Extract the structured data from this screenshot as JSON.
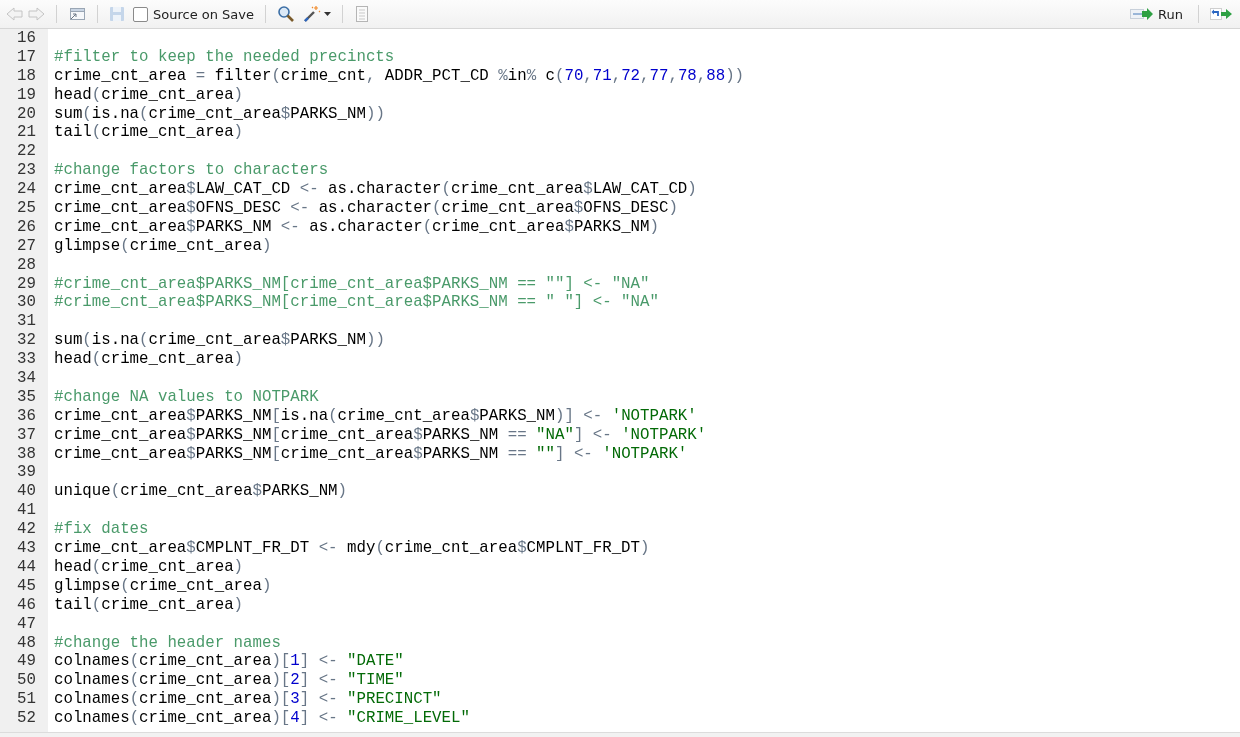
{
  "toolbar": {
    "source_on_save": {
      "label": "Source on Save",
      "checked": false
    },
    "run_button": {
      "label": "Run"
    }
  },
  "editor": {
    "lines": [
      {
        "number": "16"
      },
      {
        "number": "17",
        "text": "#filter to keep the needed precincts"
      },
      {
        "number": "18",
        "text": "crime_cnt_area = filter(crime_cnt, ADDR_PCT_CD %in% c(70,71,72,77,78,88))"
      },
      {
        "number": "19",
        "text": "head(crime_cnt_area)"
      },
      {
        "number": "20",
        "text": "sum(is.na(crime_cnt_area$PARKS_NM))"
      },
      {
        "number": "21",
        "text": "tail(crime_cnt_area)"
      },
      {
        "number": "22"
      },
      {
        "number": "23",
        "text": "#change factors to characters"
      },
      {
        "number": "24",
        "text": "crime_cnt_area$LAW_CAT_CD <- as.character(crime_cnt_area$LAW_CAT_CD)"
      },
      {
        "number": "25",
        "text": "crime_cnt_area$OFNS_DESC <- as.character(crime_cnt_area$OFNS_DESC)"
      },
      {
        "number": "26",
        "text": "crime_cnt_area$PARKS_NM <- as.character(crime_cnt_area$PARKS_NM)"
      },
      {
        "number": "27",
        "text": "glimpse(crime_cnt_area)"
      },
      {
        "number": "28"
      },
      {
        "number": "29",
        "text": "#crime_cnt_area$PARKS_NM[crime_cnt_area$PARKS_NM == \"\"] <- \"NA\""
      },
      {
        "number": "30",
        "text": "#crime_cnt_area$PARKS_NM[crime_cnt_area$PARKS_NM == \" \"] <- \"NA\""
      },
      {
        "number": "31"
      },
      {
        "number": "32",
        "text": "sum(is.na(crime_cnt_area$PARKS_NM))"
      },
      {
        "number": "33",
        "text": "head(crime_cnt_area)"
      },
      {
        "number": "34"
      },
      {
        "number": "35",
        "text": "#change NA values to NOTPARK"
      },
      {
        "number": "36",
        "text": "crime_cnt_area$PARKS_NM[is.na(crime_cnt_area$PARKS_NM)] <- 'NOTPARK'"
      },
      {
        "number": "37",
        "text": "crime_cnt_area$PARKS_NM[crime_cnt_area$PARKS_NM == \"NA\"] <- 'NOTPARK'"
      },
      {
        "number": "38",
        "text": "crime_cnt_area$PARKS_NM[crime_cnt_area$PARKS_NM == \"\"] <- 'NOTPARK'"
      },
      {
        "number": "39"
      },
      {
        "number": "40",
        "text": "unique(crime_cnt_area$PARKS_NM)"
      },
      {
        "number": "41"
      },
      {
        "number": "42",
        "text": "#fix dates"
      },
      {
        "number": "43",
        "text": "crime_cnt_area$CMPLNT_FR_DT <- mdy(crime_cnt_area$CMPLNT_FR_DT)"
      },
      {
        "number": "44",
        "text": "head(crime_cnt_area)"
      },
      {
        "number": "45",
        "text": "glimpse(crime_cnt_area)"
      },
      {
        "number": "46",
        "text": "tail(crime_cnt_area)"
      },
      {
        "number": "47"
      },
      {
        "number": "48",
        "text": "#change the header names"
      },
      {
        "number": "49",
        "text": "colnames(crime_cnt_area)[1] <- \"DATE\""
      },
      {
        "number": "50",
        "text": "colnames(crime_cnt_area)[2] <- \"TIME\""
      },
      {
        "number": "51",
        "text": "colnames(crime_cnt_area)[3] <- \"PRECINCT\""
      },
      {
        "number": "52",
        "text": "colnames(crime_cnt_area)[4] <- \"CRIME_LEVEL\""
      }
    ]
  }
}
